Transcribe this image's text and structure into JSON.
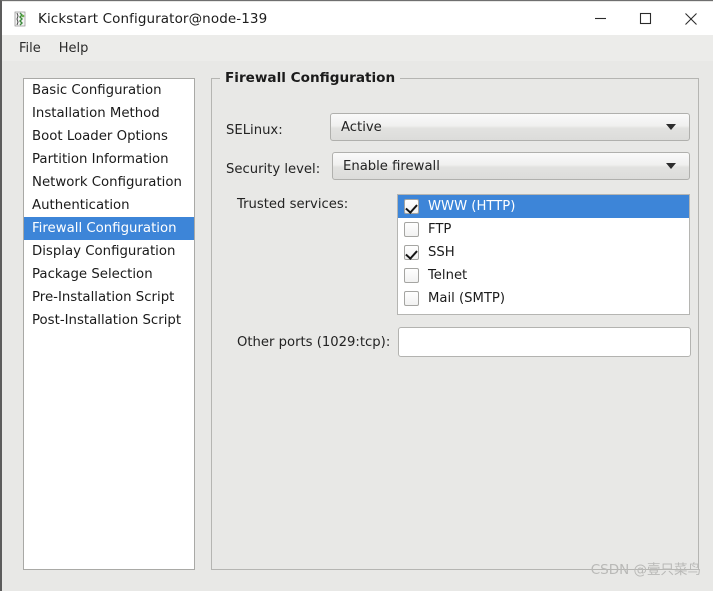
{
  "window": {
    "title": "Kickstart Configurator@node-139",
    "app_icon": "kickstart-icon",
    "minimize_label": "—",
    "maximize_label": "□",
    "close_label": "✕"
  },
  "menubar": {
    "items": [
      {
        "label": "File"
      },
      {
        "label": "Help"
      }
    ]
  },
  "sidebar": {
    "items": [
      {
        "label": "Basic Configuration",
        "selected": false
      },
      {
        "label": "Installation Method",
        "selected": false
      },
      {
        "label": "Boot Loader Options",
        "selected": false
      },
      {
        "label": "Partition Information",
        "selected": false
      },
      {
        "label": "Network Configuration",
        "selected": false
      },
      {
        "label": "Authentication",
        "selected": false
      },
      {
        "label": "Firewall Configuration",
        "selected": true
      },
      {
        "label": "Display Configuration",
        "selected": false
      },
      {
        "label": "Package Selection",
        "selected": false
      },
      {
        "label": "Pre-Installation Script",
        "selected": false
      },
      {
        "label": "Post-Installation Script",
        "selected": false
      }
    ]
  },
  "panel": {
    "legend": "Firewall Configuration",
    "selinux": {
      "label": "SELinux:",
      "value": "Active"
    },
    "security_level": {
      "label": "Security level:",
      "value": "Enable firewall"
    },
    "trusted_services": {
      "label": "Trusted services:",
      "items": [
        {
          "label": "WWW (HTTP)",
          "checked": true,
          "selected": true
        },
        {
          "label": "FTP",
          "checked": false,
          "selected": false
        },
        {
          "label": "SSH",
          "checked": true,
          "selected": false
        },
        {
          "label": "Telnet",
          "checked": false,
          "selected": false
        },
        {
          "label": "Mail (SMTP)",
          "checked": false,
          "selected": false
        }
      ]
    },
    "other_ports": {
      "label": "Other ports (1029:tcp):",
      "value": "",
      "placeholder": ""
    }
  },
  "watermark": {
    "text": "CSDN @壹只菜鸟"
  },
  "colors": {
    "selection_blue": "#3d85d8",
    "window_bg": "#e8e8e6",
    "menubar_bg": "#ececea",
    "list_bg": "#ffffff",
    "border": "#b5b5b2"
  }
}
